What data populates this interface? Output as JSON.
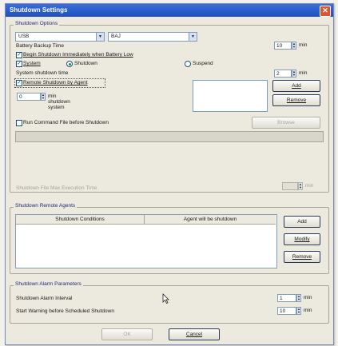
{
  "window": {
    "title": "Shutdown Settings",
    "close_glyph": "✕"
  },
  "shutdown_options": {
    "title": "Shutdown Options",
    "port_value": "USB",
    "model_value": "BAJ",
    "battery_backup_label": "Battery Backup Time",
    "battery_backup_value": "10",
    "battery_backup_unit": "min",
    "begin_shutdown_label": "Begin Shutdown Immediately when Battery Low",
    "begin_shutdown_checked": true,
    "system_label": "System",
    "system_checked": true,
    "shutdown_radio_label": "Shutdown",
    "suspend_radio_label": "Suspend",
    "system_shutdown_time_label": "System shutdown time",
    "system_shutdown_time_value": "2",
    "system_shutdown_time_unit": "min",
    "remote_shutdown_label": "Remote Shutdown by Agent",
    "remote_shutdown_checked": true,
    "agent_delay_value": "0",
    "agent_delay_label": "min shutdown system",
    "add_label": "Add",
    "remove_label": "Remove",
    "run_command_label": "Run Command File before Shutdown",
    "run_command_checked": false,
    "browse_label": "Browse",
    "command_exec_time_label": "Shutdown File Max Execution Time",
    "command_exec_time_unit": "min"
  },
  "remote_agents": {
    "title": "Shutdown Remote Agents",
    "columns": [
      "Shutdown Conditions",
      "Agent will be shutdown"
    ],
    "add_label": "Add",
    "modify_label": "Modify",
    "remove_label": "Remove"
  },
  "alarm": {
    "title": "Shutdown Alarm Parameters",
    "interval_label": "Shutdown Alarm Interval",
    "interval_value": "1",
    "interval_unit": "min",
    "start_warning_label": "Start Warning before Scheduled Shutdown",
    "start_warning_value": "10",
    "start_warning_unit": "min"
  },
  "footer": {
    "ok_label": "OK",
    "cancel_label": "Cancel"
  },
  "colors": {
    "titlebar": "#2b5cc9",
    "group_title": "#1c2e78",
    "close": "#d9562f"
  }
}
